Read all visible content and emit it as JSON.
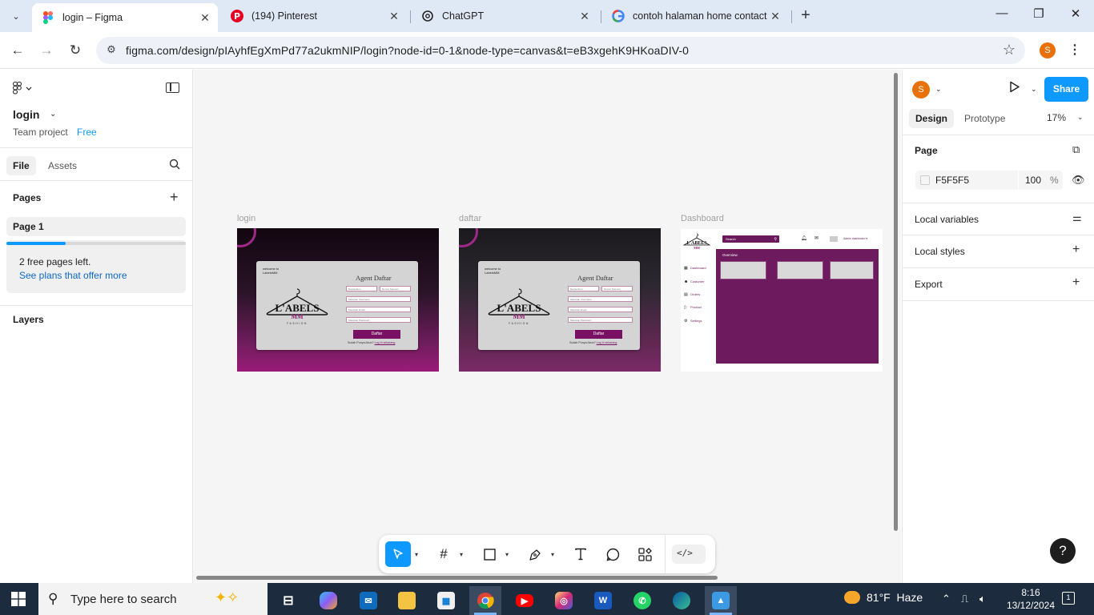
{
  "browser": {
    "tabs": [
      {
        "title": "login – Figma",
        "icon": "figma-icon",
        "active": true
      },
      {
        "title": "(194) Pinterest",
        "icon": "pinterest-icon",
        "active": false
      },
      {
        "title": "ChatGPT",
        "icon": "chatgpt-icon",
        "active": false
      },
      {
        "title": "contoh halaman home contact",
        "icon": "google-icon",
        "active": false
      }
    ],
    "url": "figma.com/design/pIAyhfEgXmPd77a2ukmNIP/login?node-id=0-1&node-type=canvas&t=eB3xgehK9HKoaDIV-0",
    "profile_initial": "S"
  },
  "left_panel": {
    "file_name": "login",
    "team": "Team project",
    "plan": "Free",
    "tabs": [
      "File",
      "Assets"
    ],
    "pages_heading": "Pages",
    "pages": [
      "Page 1"
    ],
    "promo_text": "2 free pages left.",
    "promo_link": "See plans that offer more",
    "promo_progress": 0.33,
    "layers_heading": "Layers"
  },
  "canvas": {
    "background": "#F5F5F5",
    "frames": [
      {
        "label": "login",
        "welcome": "welcome to LabelsMM",
        "logo_main": "L'ABELS",
        "logo_sub": "MM",
        "logo_tag": "FASHION",
        "heading": "Agent Daftar",
        "fields": [
          "Nama Akun",
          "Nomor Sponsor",
          "Masukan Username",
          "Masukan Email",
          "Masukan Password"
        ],
        "button": "Daftar",
        "footer_prefix": "Sudah Punya Akun?",
        "footer_link": "Log In sekarang"
      },
      {
        "label": "daftar",
        "welcome": "welcome to LabelsMM",
        "logo_main": "L'ABELS",
        "logo_sub": "MM",
        "logo_tag": "FASHION",
        "heading": "Agent Daftar",
        "fields": [
          "Nama Akun",
          "Nomor Sponsor",
          "Masukan Username",
          "Masukan Email",
          "Masukan Password"
        ],
        "button": "Daftar",
        "footer_prefix": "Sudah Punya Akun?",
        "footer_link": "Log In sekarang"
      }
    ],
    "dashboard": {
      "label": "Dashboard",
      "search": "Search",
      "admin": "Admin dashboard",
      "nav": [
        "Dashboard",
        "Costumer",
        "Orders",
        "Product",
        "Settings"
      ],
      "overview": "Overview"
    }
  },
  "toolbar": {
    "tools": [
      "move-tool",
      "frame-tool",
      "shape-tool",
      "pen-tool",
      "text-tool",
      "comment-tool",
      "actions-tool"
    ],
    "dev_mode": "</>"
  },
  "right_panel": {
    "avatar_initial": "S",
    "share": "Share",
    "tabs": [
      "Design",
      "Prototype"
    ],
    "zoom": "17%",
    "page_heading": "Page",
    "page_color": "F5F5F5",
    "page_opacity": "100",
    "page_opacity_unit": "%",
    "local_variables": "Local variables",
    "local_styles": "Local styles",
    "export": "Export",
    "help": "?"
  },
  "taskbar": {
    "search_placeholder": "Type here to search",
    "weather_temp": "81°F",
    "weather_cond": "Haze",
    "time": "8:16",
    "date": "13/12/2024",
    "notifications": "1",
    "apps": [
      "task-view",
      "copilot",
      "mail",
      "file-explorer",
      "microsoft-store",
      "chrome",
      "youtube",
      "instagram",
      "word",
      "whatsapp",
      "edge",
      "photos"
    ]
  }
}
